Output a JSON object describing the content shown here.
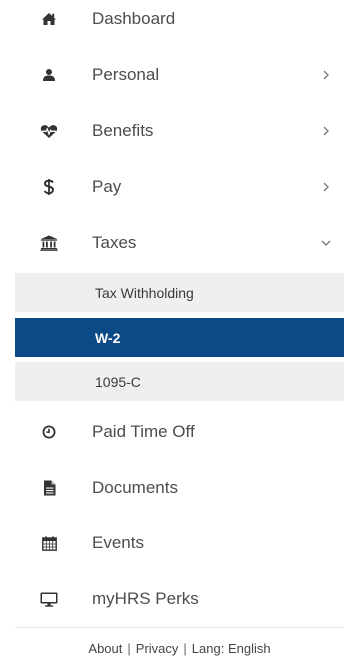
{
  "nav": {
    "items": [
      {
        "label": "Dashboard",
        "icon": "home-icon",
        "chevron": "none"
      },
      {
        "label": "Personal",
        "icon": "person-icon",
        "chevron": "right"
      },
      {
        "label": "Benefits",
        "icon": "heartbeat-icon",
        "chevron": "right"
      },
      {
        "label": "Pay",
        "icon": "dollar-icon",
        "chevron": "right"
      },
      {
        "label": "Taxes",
        "icon": "bank-icon",
        "chevron": "down"
      }
    ],
    "taxes_sub": [
      {
        "label": "Tax Withholding",
        "active": false
      },
      {
        "label": "W-2",
        "active": true
      },
      {
        "label": "1095-C",
        "active": false
      }
    ],
    "items_after": [
      {
        "label": "Paid Time Off",
        "icon": "clock-icon"
      },
      {
        "label": "Documents",
        "icon": "document-icon"
      },
      {
        "label": "Events",
        "icon": "calendar-icon"
      },
      {
        "label": "myHRS Perks",
        "icon": "monitor-icon"
      }
    ]
  },
  "footer": {
    "about": "About",
    "privacy": "Privacy",
    "lang": "Lang: English",
    "separator": "|"
  },
  "colors": {
    "active_bg": "#0b4a87",
    "submenu_bg": "#efefef",
    "text": "#4d4d4d"
  }
}
